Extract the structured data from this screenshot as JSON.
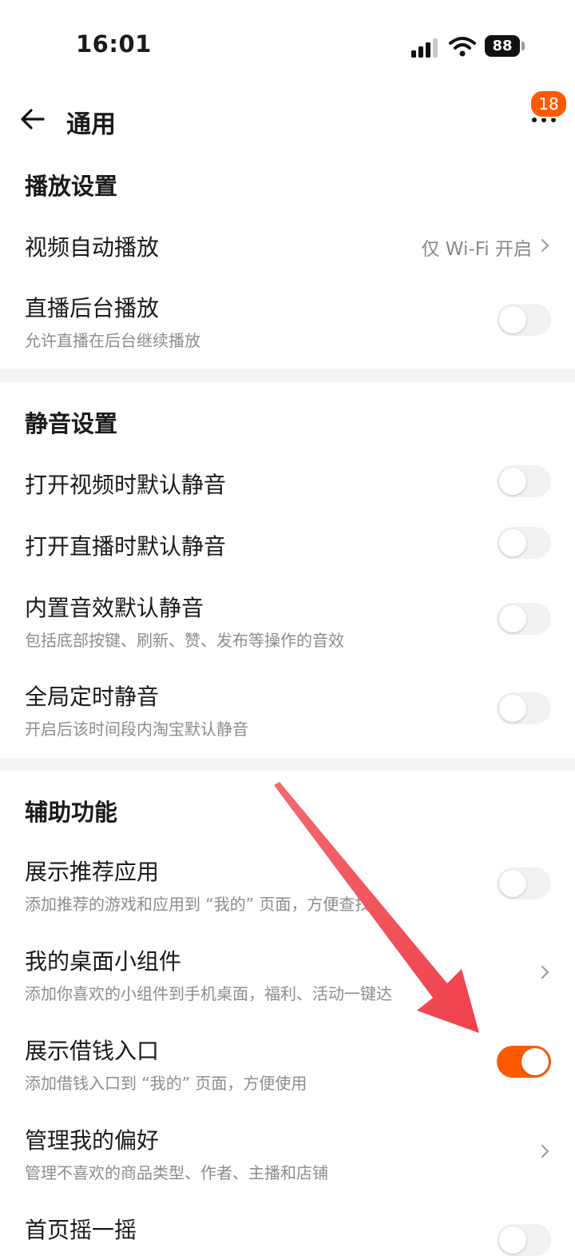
{
  "status_bar": {
    "time": "16:01",
    "battery": "88"
  },
  "nav": {
    "title": "通用",
    "badge": "18"
  },
  "sections": {
    "playback": {
      "title": "播放设置",
      "video_autoplay": {
        "title": "视频自动播放",
        "value": "仅 Wi-Fi 开启"
      },
      "live_background": {
        "title": "直播后台播放",
        "subtitle": "允许直播在后台继续播放",
        "enabled": false
      }
    },
    "mute": {
      "title": "静音设置",
      "video_mute": {
        "title": "打开视频时默认静音",
        "enabled": false
      },
      "live_mute": {
        "title": "打开直播时默认静音",
        "enabled": false
      },
      "sound_effects": {
        "title": "内置音效默认静音",
        "subtitle": "包括底部按键、刷新、赞、发布等操作的音效",
        "enabled": false
      },
      "timed_mute": {
        "title": "全局定时静音",
        "subtitle": "开启后该时间段内淘宝默认静音",
        "enabled": false
      }
    },
    "assist": {
      "title": "辅助功能",
      "recommended_apps": {
        "title": "展示推荐应用",
        "subtitle": "添加推荐的游戏和应用到 “我的” 页面，方便查找",
        "enabled": false
      },
      "widgets": {
        "title": "我的桌面小组件",
        "subtitle": "添加你喜欢的小组件到手机桌面，福利、活动一键达"
      },
      "loan_entry": {
        "title": "展示借钱入口",
        "subtitle": "添加借钱入口到 “我的” 页面，方便使用",
        "enabled": true
      },
      "preferences": {
        "title": "管理我的偏好",
        "subtitle": "管理不喜欢的商品类型、作者、主播和店铺"
      },
      "shake": {
        "title": "首页摇一摇",
        "enabled": false
      }
    }
  },
  "colors": {
    "accent": "#ff5a00",
    "arrow": "#f2545b",
    "toggle_off": "#f2f2f2"
  }
}
